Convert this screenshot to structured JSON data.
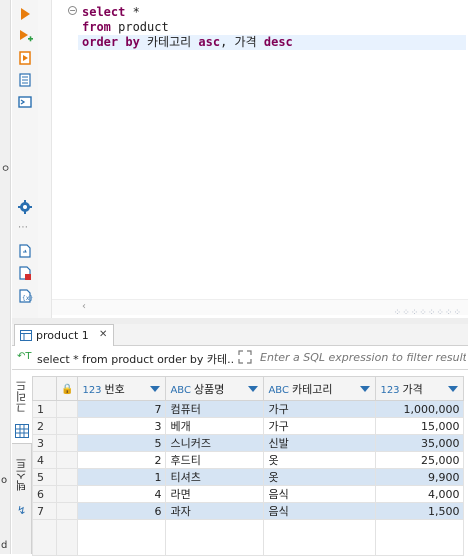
{
  "left_edge": {
    "fragment_top": "ㅇ",
    "fragment_mid": "o",
    "fragment_bottom": "d"
  },
  "toolbar": {
    "icons": [
      "execute-statement-icon",
      "execute-in-new-tab-icon",
      "execute-script-icon",
      "explain-plan-icon",
      "show-output-icon",
      "settings-icon",
      "export-icon",
      "import-icon",
      "template-icon"
    ]
  },
  "editor": {
    "line1": {
      "kw": "select",
      "rest": " *"
    },
    "line2": {
      "kw": "from",
      "rest": " product"
    },
    "line3": {
      "kw1": "order by",
      "mid1": " 카테고리 ",
      "kw2": "asc",
      "mid2": ", 가격 ",
      "kw3": "desc"
    }
  },
  "results_tab": {
    "label": "product 1",
    "close": "✕"
  },
  "filter": {
    "query_text": "select * from product order by 카테..",
    "placeholder": "Enter a SQL expression to filter results"
  },
  "side_tabs": {
    "grid": "그리드",
    "text": "텍스트"
  },
  "grid": {
    "columns": [
      {
        "type": "123",
        "name": "번호"
      },
      {
        "type": "ABC",
        "name": "상품명"
      },
      {
        "type": "ABC",
        "name": "카테고리"
      },
      {
        "type": "123",
        "name": "가격"
      }
    ],
    "rows": [
      {
        "n": "1",
        "id": "7",
        "name": "컴퓨터",
        "cat": "가구",
        "price": "1,000,000"
      },
      {
        "n": "2",
        "id": "3",
        "name": "베개",
        "cat": "가구",
        "price": "15,000"
      },
      {
        "n": "3",
        "id": "5",
        "name": "스니커즈",
        "cat": "신발",
        "price": "35,000"
      },
      {
        "n": "4",
        "id": "2",
        "name": "후드티",
        "cat": "옷",
        "price": "25,000"
      },
      {
        "n": "5",
        "id": "1",
        "name": "티셔츠",
        "cat": "옷",
        "price": "9,900"
      },
      {
        "n": "6",
        "id": "4",
        "name": "라면",
        "cat": "음식",
        "price": "4,000"
      },
      {
        "n": "7",
        "id": "6",
        "name": "과자",
        "cat": "음식",
        "price": "1,500"
      }
    ]
  },
  "colors": {
    "keyword": "#7f0055",
    "accent": "#2a6fb0",
    "selection": "#d6e4f3",
    "toolbar_orange": "#e87d0d"
  }
}
